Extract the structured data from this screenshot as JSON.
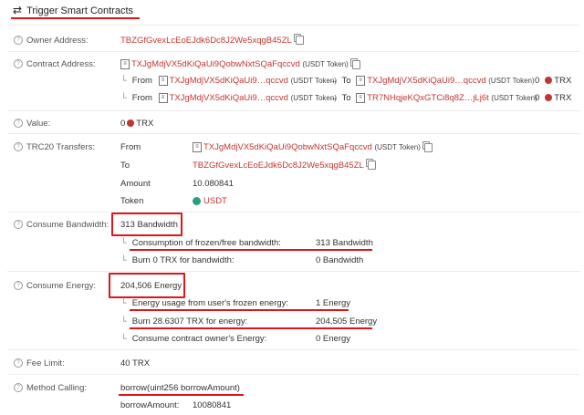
{
  "header": {
    "title": "Trigger Smart Contracts",
    "icon": "swap-arrows-icon"
  },
  "owner": {
    "label": "Owner Address:",
    "address": "TBZGfGvexLcEoEJdk6Dc8J2We5xqgB45ZL"
  },
  "contract": {
    "label": "Contract Address:",
    "address": "TXJgMdjVX5dKiQaUi9QobwNxtSQaFqccvd",
    "tag": "(USDT Token)",
    "transfers": [
      {
        "from_label": "From",
        "from": "TXJgMdjVX5dKiQaUi9…qccvd",
        "from_tag": "(USDT Token)",
        "to_label": "To",
        "to": "TXJgMdjVX5dKiQaUi9…qccvd",
        "to_tag": "(USDT Token)",
        "amount": "0",
        "unit": "TRX"
      },
      {
        "from_label": "From",
        "from": "TXJgMdjVX5dKiQaUi9…qccvd",
        "from_tag": "(USDT Token)",
        "to_label": "To",
        "to": "TR7NHqjeKQxGTCi8q8Z…jLj6t",
        "to_tag": "(USDT Token)",
        "amount": "0",
        "unit": "TRX"
      }
    ]
  },
  "value": {
    "label": "Value:",
    "amount": "0",
    "unit": "TRX"
  },
  "trc20": {
    "label": "TRC20 Transfers:",
    "from_label": "From",
    "from": "TXJgMdjVX5dKiQaUi9QobwNxtSQaFqccvd",
    "from_tag": "(USDT Token)",
    "to_label": "To",
    "to": "TBZGfGvexLcEoEJdk6Dc8J2We5xqgB45ZL",
    "amount_label": "Amount",
    "amount": "10.080841",
    "token_label": "Token",
    "token": "USDT"
  },
  "bandwidth": {
    "label": "Consume Bandwidth:",
    "total": "313 Bandwidth",
    "rows": [
      {
        "label": "Consumption of frozen/free bandwidth:",
        "value": "313 Bandwidth"
      },
      {
        "label": "Burn 0 TRX for bandwidth:",
        "value": "0 Bandwidth"
      }
    ]
  },
  "energy": {
    "label": "Consume Energy:",
    "total": "204,506 Energy",
    "rows": [
      {
        "label": "Energy usage from user's frozen energy:",
        "value": "1 Energy"
      },
      {
        "label": "Burn 28.6307 TRX for energy:",
        "value": "204,505 Energy"
      },
      {
        "label": "Consume contract owner's Energy:",
        "value": "0 Energy"
      }
    ]
  },
  "fee": {
    "label": "Fee Limit:",
    "value": "40 TRX"
  },
  "method": {
    "label": "Method Calling:",
    "signature": "borrow(uint256 borrowAmount)",
    "param_name": "borrowAmount:",
    "param_value": "10080841"
  },
  "colors": {
    "link": "#c23631",
    "annotation": "#e0151b",
    "usdt": "#26a17b"
  }
}
